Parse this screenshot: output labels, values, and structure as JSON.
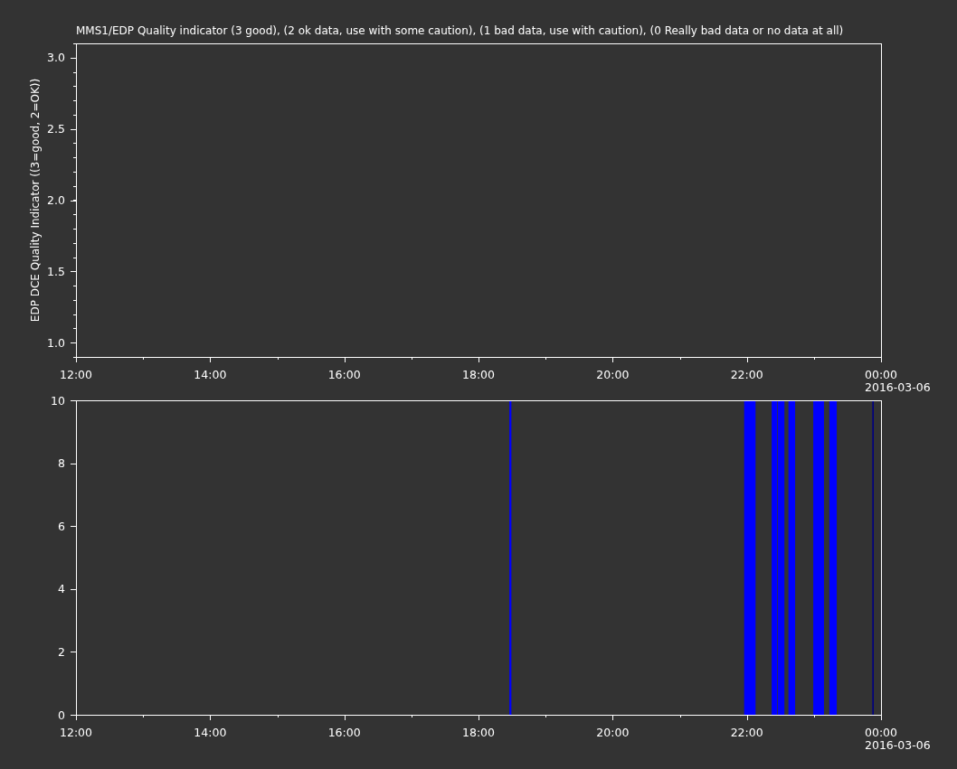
{
  "plots": [
    {
      "chart_data": {
        "type": "line",
        "title": "MMS1/EDP  Quality indicator (3 good), (2 ok data, use with some caution), (1 bad data, use with caution), (0 Really bad data or no data at all)",
        "ylabel": "EDP DCE Quality Indicator ((3=good, 2=OK))",
        "xlim": [
          12,
          24
        ],
        "ylim": [
          0.9,
          3.1
        ],
        "xticks": [
          {
            "value": 12,
            "label": "12:00"
          },
          {
            "value": 14,
            "label": "14:00"
          },
          {
            "value": 16,
            "label": "16:00"
          },
          {
            "value": 18,
            "label": "18:00"
          },
          {
            "value": 20,
            "label": "20:00"
          },
          {
            "value": 22,
            "label": "22:00"
          },
          {
            "value": 24,
            "label": "00:00"
          }
        ],
        "yticks": [
          {
            "value": 1,
            "label": "1.0"
          },
          {
            "value": 1.5,
            "label": "1.5"
          },
          {
            "value": 2,
            "label": "2.0"
          },
          {
            "value": 2.5,
            "label": "2.5"
          },
          {
            "value": 3,
            "label": "3.0"
          }
        ],
        "annotations": [
          "2016-03-06"
        ]
      }
    },
    {
      "chart_data": {
        "type": "area",
        "xlim": [
          12,
          24
        ],
        "ylim": [
          0,
          10
        ],
        "x": [
          18.46,
          18.49,
          21.96,
          22.13,
          22.37,
          22.45,
          22.46,
          22.56,
          22.62,
          22.72,
          22.99,
          23.15,
          23.23,
          23.34,
          23.87,
          23.892
        ],
        "series": [
          {
            "color": "#0000ff",
            "values": [
              10,
              10,
              null,
              null,
              null,
              null,
              null,
              null,
              null,
              null,
              null,
              null,
              null,
              null,
              null,
              null
            ]
          },
          {
            "color": "#0000ff",
            "values": [
              null,
              null,
              10,
              10,
              null,
              null,
              null,
              null,
              null,
              null,
              null,
              null,
              null,
              null,
              null,
              null
            ]
          },
          {
            "color": "#0000ff",
            "values": [
              null,
              null,
              null,
              null,
              10,
              10,
              null,
              null,
              null,
              null,
              null,
              null,
              null,
              null,
              null,
              null
            ]
          },
          {
            "color": "#0000ff",
            "values": [
              null,
              null,
              null,
              null,
              null,
              null,
              10,
              10,
              null,
              null,
              null,
              null,
              null,
              null,
              null,
              null
            ]
          },
          {
            "color": "#0000ff",
            "values": [
              null,
              null,
              null,
              null,
              null,
              null,
              null,
              null,
              10,
              10,
              null,
              null,
              null,
              null,
              null,
              null
            ]
          },
          {
            "color": "#0000ff",
            "values": [
              null,
              null,
              null,
              null,
              null,
              null,
              null,
              null,
              null,
              null,
              10,
              10,
              null,
              null,
              null,
              null
            ]
          },
          {
            "color": "#0000ff",
            "values": [
              null,
              null,
              null,
              null,
              null,
              null,
              null,
              null,
              null,
              null,
              null,
              null,
              10,
              10,
              null,
              null
            ]
          },
          {
            "color": "#000080",
            "values": [
              null,
              null,
              null,
              null,
              null,
              null,
              null,
              null,
              null,
              null,
              null,
              null,
              null,
              null,
              10,
              10
            ]
          }
        ],
        "xticks": [
          {
            "value": 12,
            "label": "12:00"
          },
          {
            "value": 14,
            "label": "14:00"
          },
          {
            "value": 16,
            "label": "16:00"
          },
          {
            "value": 18,
            "label": "18:00"
          },
          {
            "value": 20,
            "label": "20:00"
          },
          {
            "value": 22,
            "label": "22:00"
          },
          {
            "value": 24,
            "label": "00:00"
          }
        ],
        "yticks": [
          0,
          2,
          4,
          6,
          8,
          10
        ],
        "annotations": [
          "2016-03-06"
        ]
      }
    }
  ]
}
